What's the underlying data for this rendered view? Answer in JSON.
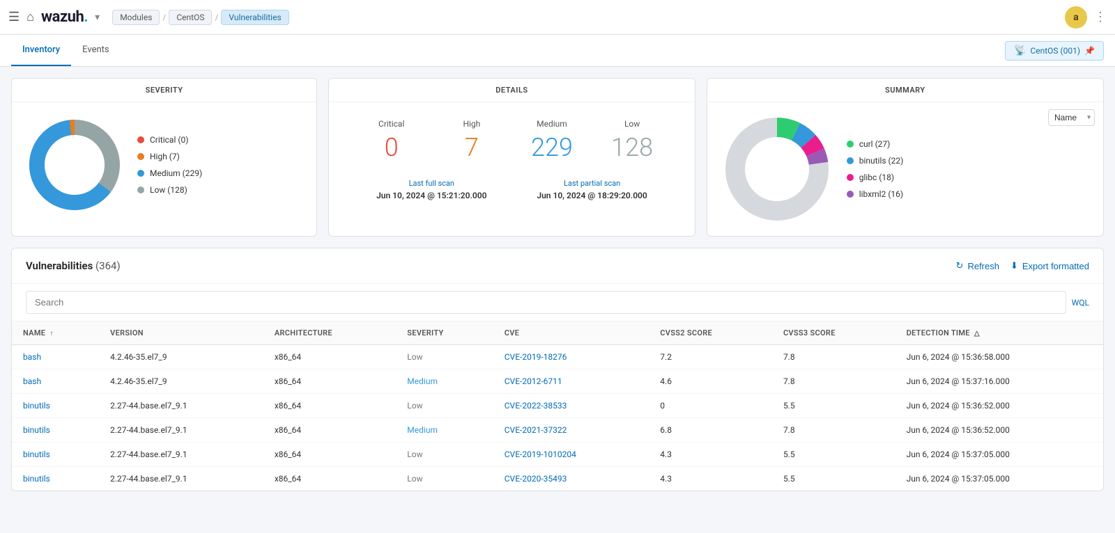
{
  "topnav": {
    "hamburger": "☰",
    "home": "⌂",
    "logo": "wazuh.",
    "chevron": "▾",
    "breadcrumbs": [
      {
        "label": "Modules",
        "active": false
      },
      {
        "label": "CentOS",
        "active": false
      },
      {
        "label": "Vulnerabilities",
        "active": true
      }
    ],
    "user_initial": "a",
    "dots": "⋮"
  },
  "tabs": [
    {
      "label": "Inventory",
      "active": true
    },
    {
      "label": "Events",
      "active": false
    }
  ],
  "agent_badge": {
    "icon": "📡",
    "label": "CentOS (001)"
  },
  "severity_card": {
    "title": "SEVERITY",
    "legend": [
      {
        "label": "Critical (0)",
        "color": "#e74c3c"
      },
      {
        "label": "High (7)",
        "color": "#e67e22"
      },
      {
        "label": "Medium (229)",
        "color": "#3498db"
      },
      {
        "label": "Low (128)",
        "color": "#95a5a6"
      }
    ],
    "donut": {
      "critical": 0,
      "high": 7,
      "medium": 229,
      "low": 128,
      "total": 364
    }
  },
  "details_card": {
    "title": "DETAILS",
    "critical_label": "Critical",
    "critical_value": "0",
    "high_label": "High",
    "high_value": "7",
    "medium_label": "Medium",
    "medium_value": "229",
    "low_label": "Low",
    "low_value": "128",
    "last_full_scan_label": "Last full scan",
    "last_full_scan": "Jun 10, 2024 @ 15:21:20.000",
    "last_partial_scan_label": "Last partial scan",
    "last_partial_scan": "Jun 10, 2024 @ 18:29:20.000"
  },
  "summary_card": {
    "title": "SUMMARY",
    "name_select_label": "Name",
    "legend": [
      {
        "label": "curl (27)",
        "color": "#2ecc71"
      },
      {
        "label": "binutils (22)",
        "color": "#3498db"
      },
      {
        "label": "glibc (18)",
        "color": "#e91e8c"
      },
      {
        "label": "libxml2 (16)",
        "color": "#9b59b6"
      }
    ],
    "donut": {
      "segments": [
        {
          "value": 27,
          "color": "#2ecc71"
        },
        {
          "value": 22,
          "color": "#3498db"
        },
        {
          "value": 18,
          "color": "#e91e8c"
        },
        {
          "value": 16,
          "color": "#9b59b6"
        },
        {
          "value": 281,
          "color": "#ecf0f1"
        }
      ]
    }
  },
  "vulnerabilities": {
    "title": "Vulnerabilities",
    "count": "(364)",
    "refresh_label": "Refresh",
    "export_label": "Export formatted",
    "search_placeholder": "Search",
    "wql_label": "WQL",
    "columns": [
      {
        "key": "name",
        "label": "Name",
        "sort": "asc"
      },
      {
        "key": "version",
        "label": "Version",
        "sort": null
      },
      {
        "key": "architecture",
        "label": "Architecture",
        "sort": null
      },
      {
        "key": "severity",
        "label": "Severity",
        "sort": null
      },
      {
        "key": "cve",
        "label": "CVE",
        "sort": null
      },
      {
        "key": "cvss2",
        "label": "CVSS2 Score",
        "sort": null
      },
      {
        "key": "cvss3",
        "label": "CVSS3 Score",
        "sort": null
      },
      {
        "key": "detection_time",
        "label": "Detection Time",
        "sort": "asc"
      }
    ],
    "rows": [
      {
        "name": "bash",
        "version": "4.2.46-35.el7_9",
        "architecture": "x86_64",
        "severity": "Low",
        "cve": "CVE-2019-18276",
        "cvss2": "7.2",
        "cvss3": "7.8",
        "detection_time": "Jun 6, 2024 @ 15:36:58.000"
      },
      {
        "name": "bash",
        "version": "4.2.46-35.el7_9",
        "architecture": "x86_64",
        "severity": "Medium",
        "cve": "CVE-2012-6711",
        "cvss2": "4.6",
        "cvss3": "7.8",
        "detection_time": "Jun 6, 2024 @ 15:37:16.000"
      },
      {
        "name": "binutils",
        "version": "2.27-44.base.el7_9.1",
        "architecture": "x86_64",
        "severity": "Low",
        "cve": "CVE-2022-38533",
        "cvss2": "0",
        "cvss3": "5.5",
        "detection_time": "Jun 6, 2024 @ 15:36:52.000"
      },
      {
        "name": "binutils",
        "version": "2.27-44.base.el7_9.1",
        "architecture": "x86_64",
        "severity": "Medium",
        "cve": "CVE-2021-37322",
        "cvss2": "6.8",
        "cvss3": "7.8",
        "detection_time": "Jun 6, 2024 @ 15:36:52.000"
      },
      {
        "name": "binutils",
        "version": "2.27-44.base.el7_9.1",
        "architecture": "x86_64",
        "severity": "Low",
        "cve": "CVE-2019-1010204",
        "cvss2": "4.3",
        "cvss3": "5.5",
        "detection_time": "Jun 6, 2024 @ 15:37:05.000"
      },
      {
        "name": "binutils",
        "version": "2.27-44.base.el7_9.1",
        "architecture": "x86_64",
        "severity": "Low",
        "cve": "CVE-2020-35493",
        "cvss2": "4.3",
        "cvss3": "5.5",
        "detection_time": "Jun 6, 2024 @ 15:37:05.000"
      }
    ]
  }
}
